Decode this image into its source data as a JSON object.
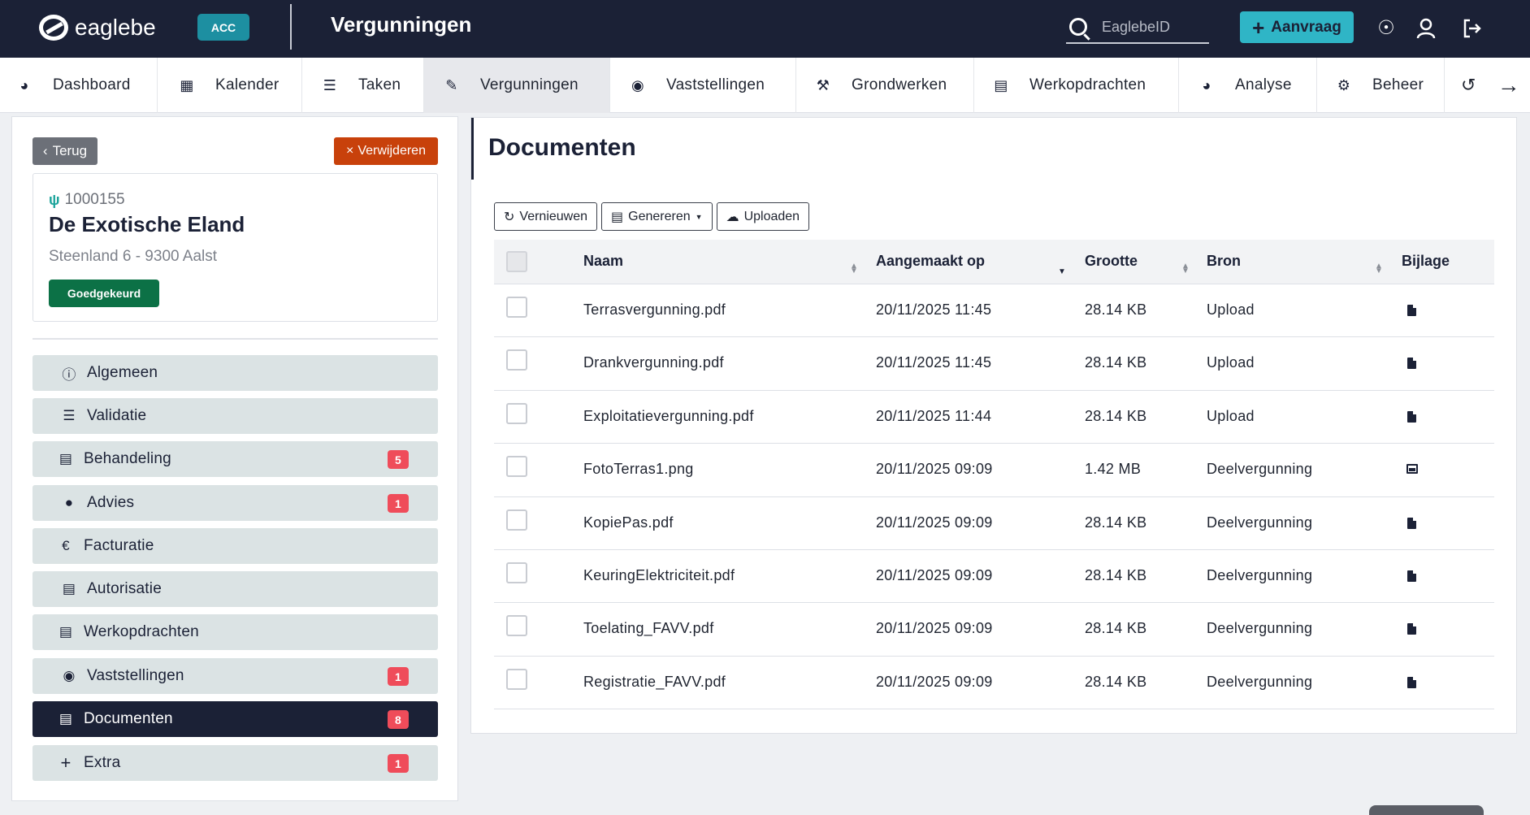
{
  "app": {
    "logo_text": "eaglebe",
    "env_badge": "ACC",
    "page_title": "Vergunningen",
    "search_placeholder": "EaglebeID",
    "aanvraag_label": "Aanvraag"
  },
  "nav": {
    "items": [
      {
        "label": "Dashboard",
        "icon": "dashboard-gauge-icon"
      },
      {
        "label": "Kalender",
        "icon": "calendar-icon"
      },
      {
        "label": "Taken",
        "icon": "tasks-list-icon"
      },
      {
        "label": "Vergunningen",
        "icon": "permit-edit-icon",
        "active": true
      },
      {
        "label": "Vaststellingen",
        "icon": "eye-icon"
      },
      {
        "label": "Grondwerken",
        "icon": "digging-icon"
      },
      {
        "label": "Werkopdrachten",
        "icon": "file-icon"
      },
      {
        "label": "Analyse",
        "icon": "gauge-icon"
      },
      {
        "label": "Beheer",
        "icon": "gears-icon"
      }
    ]
  },
  "sidebar": {
    "back_label": "Terug",
    "delete_label": "Verwijderen",
    "dossier": {
      "id": "1000155",
      "name": "De Exotische Eland",
      "address": "Steenland 6 - 9300 Aalst",
      "status": "Goedgekeurd"
    },
    "menu": [
      {
        "label": "Algemeen",
        "icon": "info-icon",
        "badge": ""
      },
      {
        "label": "Validatie",
        "icon": "checklist-icon",
        "badge": ""
      },
      {
        "label": "Behandeling",
        "icon": "file-edit-icon",
        "badge": "5"
      },
      {
        "label": "Advies",
        "icon": "comments-icon",
        "badge": "1"
      },
      {
        "label": "Facturatie",
        "icon": "euro-icon",
        "badge": ""
      },
      {
        "label": "Autorisatie",
        "icon": "file-check-icon",
        "badge": ""
      },
      {
        "label": "Werkopdrachten",
        "icon": "file-icon",
        "badge": ""
      },
      {
        "label": "Vaststellingen",
        "icon": "eye-icon",
        "badge": "1"
      },
      {
        "label": "Documenten",
        "icon": "file-icon",
        "badge": "8",
        "active": true
      },
      {
        "label": "Extra",
        "icon": "plus-icon",
        "badge": "1"
      }
    ]
  },
  "main": {
    "title": "Documenten",
    "toolbar": {
      "refresh_label": "Vernieuwen",
      "generate_label": "Genereren",
      "upload_label": "Uploaden"
    },
    "columns": {
      "name": "Naam",
      "created": "Aangemaakt op",
      "size": "Grootte",
      "source": "Bron",
      "attachment": "Bijlage"
    },
    "rows": [
      {
        "name": "Terrasvergunning.pdf",
        "created": "20/11/2025 11:45",
        "size": "28.14 KB",
        "source": "Upload",
        "attachment_icon": "file-icon"
      },
      {
        "name": "Drankvergunning.pdf",
        "created": "20/11/2025 11:45",
        "size": "28.14 KB",
        "source": "Upload",
        "attachment_icon": "file-icon"
      },
      {
        "name": "Exploitatievergunning.pdf",
        "created": "20/11/2025 11:44",
        "size": "28.14 KB",
        "source": "Upload",
        "attachment_icon": "file-icon"
      },
      {
        "name": "FotoTerras1.png",
        "created": "20/11/2025 09:09",
        "size": "1.42 MB",
        "source": "Deelvergunning",
        "attachment_icon": "image-icon"
      },
      {
        "name": "KopiePas.pdf",
        "created": "20/11/2025 09:09",
        "size": "28.14 KB",
        "source": "Deelvergunning",
        "attachment_icon": "file-icon"
      },
      {
        "name": "KeuringElektriciteit.pdf",
        "created": "20/11/2025 09:09",
        "size": "28.14 KB",
        "source": "Deelvergunning",
        "attachment_icon": "file-icon"
      },
      {
        "name": "Toelating_FAVV.pdf",
        "created": "20/11/2025 09:09",
        "size": "28.14 KB",
        "source": "Deelvergunning",
        "attachment_icon": "file-icon"
      },
      {
        "name": "Registratie_FAVV.pdf",
        "created": "20/11/2025 09:09",
        "size": "28.14 KB",
        "source": "Deelvergunning",
        "attachment_icon": "file-icon"
      }
    ]
  },
  "colors": {
    "topbar": "#1b2136",
    "accent": "#2fb5c6",
    "env_badge": "#1d8fa1",
    "delete": "#c8410b",
    "status_ok": "#0c7146",
    "badge": "#ef4c5a",
    "menu_bg": "#dbe3e4"
  }
}
